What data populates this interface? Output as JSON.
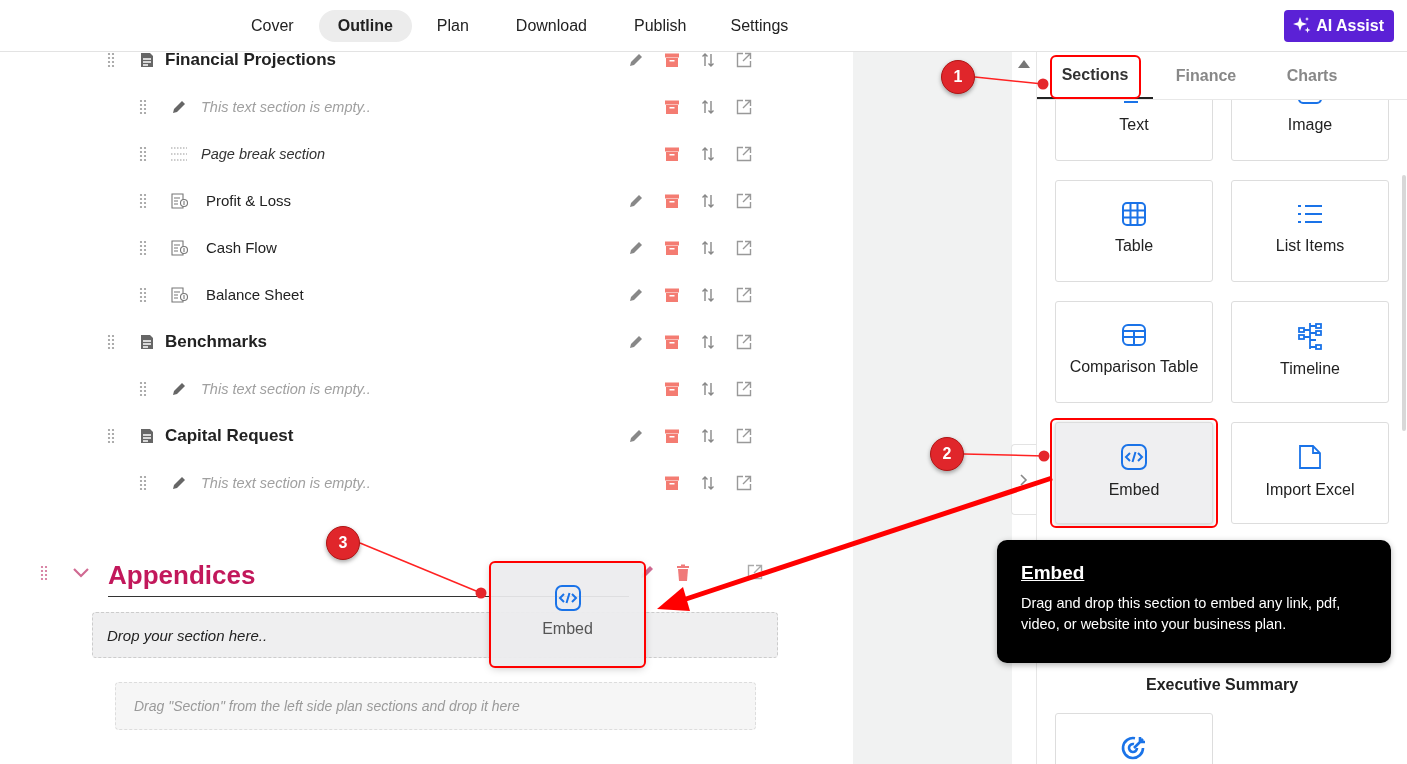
{
  "nav": {
    "tabs": [
      {
        "label": "Cover",
        "selected": false
      },
      {
        "label": "Outline",
        "selected": true
      },
      {
        "label": "Plan",
        "selected": false
      },
      {
        "label": "Download",
        "selected": false
      },
      {
        "label": "Publish",
        "selected": false
      },
      {
        "label": "Settings",
        "selected": false
      }
    ],
    "assist_button": "AI Assist"
  },
  "outline": {
    "sections": [
      {
        "kind": "heading",
        "title": "Financial Projections",
        "editable": true,
        "children": [
          {
            "kind": "empty",
            "title": "This text section is empty..",
            "editable": false
          },
          {
            "kind": "pagebreak",
            "title": "Page break section",
            "editable": false
          },
          {
            "kind": "report",
            "title": "Profit & Loss",
            "editable": true
          },
          {
            "kind": "report",
            "title": "Cash Flow",
            "editable": true
          },
          {
            "kind": "report",
            "title": "Balance Sheet",
            "editable": true
          }
        ]
      },
      {
        "kind": "heading",
        "title": "Benchmarks",
        "editable": true,
        "children": [
          {
            "kind": "empty",
            "title": "This text section is empty..",
            "editable": false
          }
        ]
      },
      {
        "kind": "heading",
        "title": "Capital Request",
        "editable": true,
        "children": [
          {
            "kind": "empty",
            "title": "This text section is empty..",
            "editable": false
          }
        ]
      }
    ],
    "chapter": {
      "title": "Appendices",
      "expanded": true,
      "drop_zone": "Drop your section here..",
      "drag_hint": "Drag \"Section\" from the left side plan sections and drop it here"
    }
  },
  "panel": {
    "tabs": [
      {
        "label": "Sections",
        "selected": true
      },
      {
        "label": "Finance",
        "selected": false
      },
      {
        "label": "Charts",
        "selected": false
      }
    ],
    "cards": [
      {
        "kind": "text",
        "label": "Text",
        "selected": false
      },
      {
        "kind": "image",
        "label": "Image",
        "selected": false
      },
      {
        "kind": "table",
        "label": "Table",
        "selected": false
      },
      {
        "kind": "list",
        "label": "List Items",
        "selected": false
      },
      {
        "kind": "comparison",
        "label": "Comparison Table",
        "selected": false
      },
      {
        "kind": "timeline",
        "label": "Timeline",
        "selected": false
      },
      {
        "kind": "embed",
        "label": "Embed",
        "selected": true
      },
      {
        "kind": "excel",
        "label": "Import Excel",
        "selected": false
      }
    ],
    "group_title": "Executive Summary",
    "group_cards": [
      {
        "kind": "goal"
      }
    ]
  },
  "tooltip": {
    "title": "Embed",
    "text": "Drag and drop this section to embed any link, pdf, video, or website into your business plan."
  },
  "drag_preview": {
    "kind": "embed",
    "label": "Embed"
  },
  "callouts": [
    {
      "number": "1"
    },
    {
      "number": "2"
    },
    {
      "number": "3"
    }
  ]
}
